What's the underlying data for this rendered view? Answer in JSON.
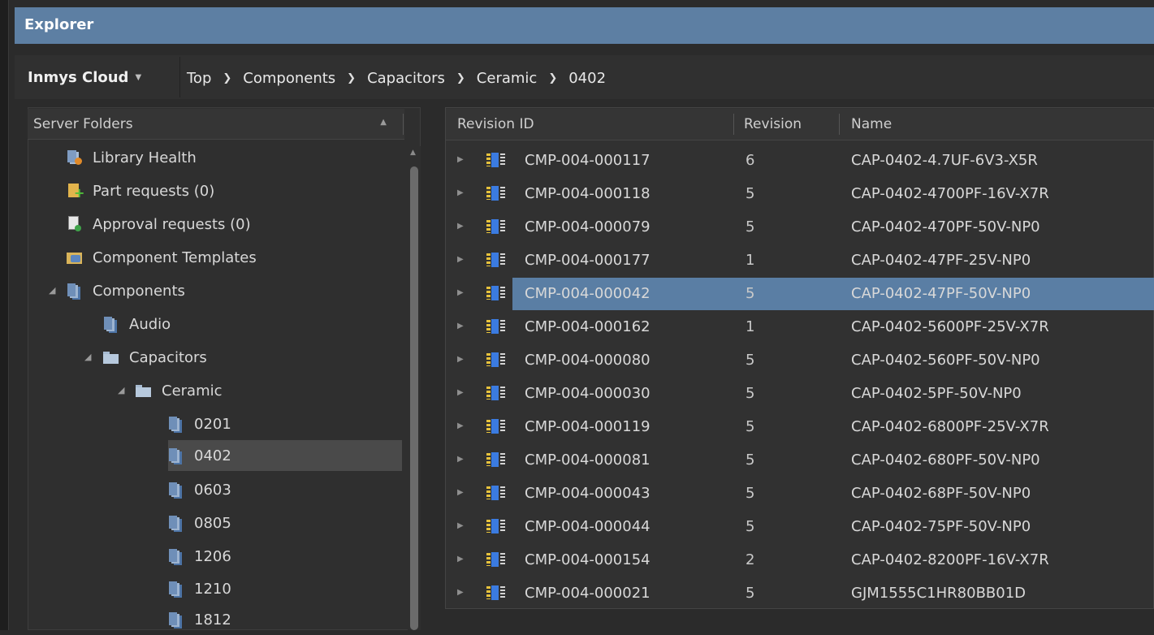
{
  "window": {
    "title": "Explorer"
  },
  "source": {
    "label": "Inmys Cloud"
  },
  "breadcrumb": [
    "Top",
    "Components",
    "Capacitors",
    "Ceramic",
    "0402"
  ],
  "left_panel": {
    "header": "Server Folders"
  },
  "tree": [
    {
      "label": "Library Health",
      "icon": "library-health-icon"
    },
    {
      "label": "Part requests (0)",
      "icon": "part-request-icon"
    },
    {
      "label": "Approval requests (0)",
      "icon": "approval-request-icon"
    },
    {
      "label": "Component Templates",
      "icon": "component-templates-icon"
    },
    {
      "label": "Components",
      "icon": "components-folder-icon",
      "expanded": true
    },
    {
      "label": "Audio",
      "icon": "components-folder-icon"
    },
    {
      "label": "Capacitors",
      "icon": "folder-icon",
      "expanded": true
    },
    {
      "label": "Ceramic",
      "icon": "folder-icon",
      "expanded": true
    },
    {
      "label": "0201",
      "icon": "components-folder-icon"
    },
    {
      "label": "0402",
      "icon": "components-folder-icon",
      "selected": true
    },
    {
      "label": "0603",
      "icon": "components-folder-icon"
    },
    {
      "label": "0805",
      "icon": "components-folder-icon"
    },
    {
      "label": "1206",
      "icon": "components-folder-icon"
    },
    {
      "label": "1210",
      "icon": "components-folder-icon"
    },
    {
      "label": "1812",
      "icon": "components-folder-icon"
    }
  ],
  "grid": {
    "columns": {
      "revision_id": "Revision ID",
      "revision": "Revision",
      "name": "Name"
    },
    "rows": [
      {
        "id": "CMP-004-000117",
        "rev": "6",
        "name": "CAP-0402-4.7UF-6V3-X5R"
      },
      {
        "id": "CMP-004-000118",
        "rev": "5",
        "name": "CAP-0402-4700PF-16V-X7R"
      },
      {
        "id": "CMP-004-000079",
        "rev": "5",
        "name": "CAP-0402-470PF-50V-NP0"
      },
      {
        "id": "CMP-004-000177",
        "rev": "1",
        "name": "CAP-0402-47PF-25V-NP0"
      },
      {
        "id": "CMP-004-000042",
        "rev": "5",
        "name": "CAP-0402-47PF-50V-NP0",
        "selected": true
      },
      {
        "id": "CMP-004-000162",
        "rev": "1",
        "name": "CAP-0402-5600PF-25V-X7R"
      },
      {
        "id": "CMP-004-000080",
        "rev": "5",
        "name": "CAP-0402-560PF-50V-NP0"
      },
      {
        "id": "CMP-004-000030",
        "rev": "5",
        "name": "CAP-0402-5PF-50V-NP0"
      },
      {
        "id": "CMP-004-000119",
        "rev": "5",
        "name": "CAP-0402-6800PF-25V-X7R"
      },
      {
        "id": "CMP-004-000081",
        "rev": "5",
        "name": "CAP-0402-680PF-50V-NP0"
      },
      {
        "id": "CMP-004-000043",
        "rev": "5",
        "name": "CAP-0402-68PF-50V-NP0"
      },
      {
        "id": "CMP-004-000044",
        "rev": "5",
        "name": "CAP-0402-75PF-50V-NP0"
      },
      {
        "id": "CMP-004-000154",
        "rev": "2",
        "name": "CAP-0402-8200PF-16V-X7R"
      },
      {
        "id": "CMP-004-000021",
        "rev": "5",
        "name": "GJM1555C1HR80BB01D"
      }
    ]
  },
  "colors": {
    "title_bar": "#5d7fa3",
    "row_selected": "#5a7ea4",
    "tree_selected": "#4a4a4a"
  }
}
